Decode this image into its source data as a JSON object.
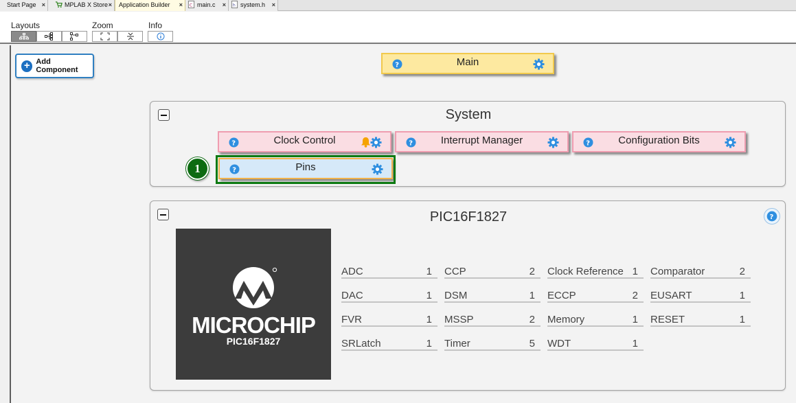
{
  "tabs": [
    {
      "label": "Start Page",
      "icon": "none",
      "active": false
    },
    {
      "label": "MPLAB X Store",
      "icon": "cart-icon",
      "active": false
    },
    {
      "label": "Application Builder",
      "icon": "none",
      "active": true
    },
    {
      "label": "main.c",
      "icon": "c-file-icon",
      "active": false
    },
    {
      "label": "system.h",
      "icon": "h-file-icon",
      "active": false
    }
  ],
  "tab_close": "×",
  "toolbar": {
    "layouts_label": "Layouts",
    "zoom_label": "Zoom",
    "info_label": "Info"
  },
  "add_component": {
    "label": "Add Component"
  },
  "main_component": {
    "label": "Main"
  },
  "system_group": {
    "title": "System",
    "components": [
      {
        "label": "Clock Control",
        "has_bell": true
      },
      {
        "label": "Interrupt Manager",
        "has_bell": false
      },
      {
        "label": "Configuration Bits",
        "has_bell": false
      },
      {
        "label": "Pins",
        "has_bell": false,
        "selected": true
      }
    ]
  },
  "step_badge": "1",
  "device_group": {
    "title": "PIC16F1827",
    "brand": "MICROCHIP",
    "part": "PIC16F1827",
    "resources": [
      {
        "name": "ADC",
        "count": "1"
      },
      {
        "name": "CCP",
        "count": "2"
      },
      {
        "name": "Clock Reference",
        "count": "1"
      },
      {
        "name": "Comparator",
        "count": "2"
      },
      {
        "name": "DAC",
        "count": "1"
      },
      {
        "name": "DSM",
        "count": "1"
      },
      {
        "name": "ECCP",
        "count": "2"
      },
      {
        "name": "EUSART",
        "count": "1"
      },
      {
        "name": "FVR",
        "count": "1"
      },
      {
        "name": "MSSP",
        "count": "2"
      },
      {
        "name": "Memory",
        "count": "1"
      },
      {
        "name": "RESET",
        "count": "1"
      },
      {
        "name": "SRLatch",
        "count": "1"
      },
      {
        "name": "Timer",
        "count": "5"
      },
      {
        "name": "WDT",
        "count": "1"
      }
    ]
  },
  "colors": {
    "help_blue": "#2f8fe0",
    "gear_blue": "#2f8fe0",
    "bell_orange": "#f5a300",
    "highlight_green": "#0d7a12"
  }
}
